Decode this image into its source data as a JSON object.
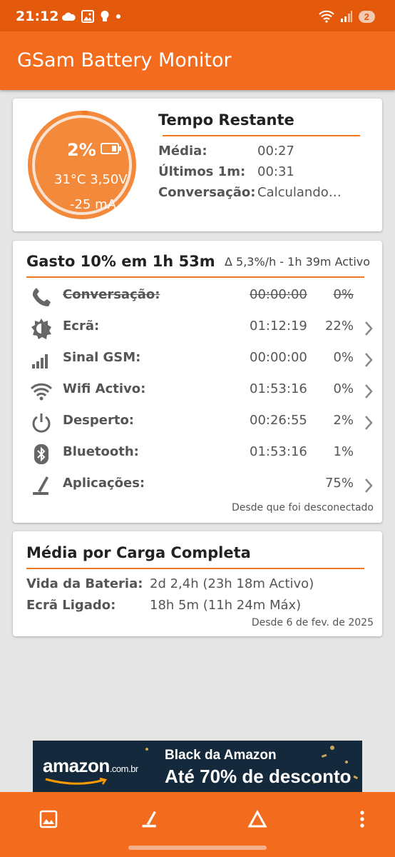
{
  "status_bar": {
    "time": "21:12",
    "notification_badge": "2",
    "icons": [
      "cloud-icon",
      "gallery-icon",
      "bulb-icon",
      "dot-icon",
      "wifi-icon",
      "signal-icon"
    ]
  },
  "app_bar": {
    "title": "GSam Battery Monitor"
  },
  "gauge": {
    "percent": "2%",
    "level_fraction": 0.02,
    "temp_voltage": "31°C  3,50V",
    "current": "-25 mA"
  },
  "tempo_restante": {
    "title": "Tempo Restante",
    "rows": [
      {
        "label": "Média:",
        "value": "00:27"
      },
      {
        "label": "Últimos 1m:",
        "value": "00:31"
      },
      {
        "label": "Conversação:",
        "value": "Calculando…"
      }
    ]
  },
  "gasto": {
    "title": "Gasto 10% em 1h 53m",
    "delta": "Δ 5,3%/h - 1h 39m Activo",
    "rows": [
      {
        "icon": "phone-icon",
        "label": "Conversação:",
        "time": "00:00:00",
        "percent": "0%",
        "struck": true,
        "chevron": false
      },
      {
        "icon": "screen-brightness-icon",
        "label": "Ecrã:",
        "time": "01:12:19",
        "percent": "22%",
        "struck": false,
        "chevron": true
      },
      {
        "icon": "signal-bars-icon",
        "label": "Sinal GSM:",
        "time": "00:00:00",
        "percent": "0%",
        "struck": false,
        "chevron": true
      },
      {
        "icon": "wifi-icon",
        "label": "Wifi Activo:",
        "time": "01:53:16",
        "percent": "0%",
        "struck": false,
        "chevron": true
      },
      {
        "icon": "power-icon",
        "label": "Desperto:",
        "time": "00:26:55",
        "percent": "2%",
        "struck": false,
        "chevron": true
      },
      {
        "icon": "bluetooth-icon",
        "label": "Bluetooth:",
        "time": "01:53:16",
        "percent": "1%",
        "struck": false,
        "chevron": false
      },
      {
        "icon": "apps-icon",
        "label": "Aplicações:",
        "time": "",
        "percent": "75%",
        "struck": false,
        "chevron": true
      }
    ],
    "footer": "Desde que foi desconectado"
  },
  "media_carga": {
    "title": "Média por Carga Completa",
    "rows": [
      {
        "label": "Vida da Bateria:",
        "value": "2d 2,4h (23h 18m Activo)"
      },
      {
        "label": "Ecrã Ligado:",
        "value": "18h 5m (11h 24m Máx)"
      }
    ],
    "footer": "Desde 6 de fev. de 2025"
  },
  "ad": {
    "brand": "amazon",
    "brand_suffix": ".com.br",
    "line1": "Black da Amazon",
    "line2": "Até 70% de desconto"
  },
  "bottom_bar": {
    "icons": [
      "image-icon",
      "apps-icon",
      "delta-icon",
      "more-vert-icon"
    ]
  },
  "colors": {
    "accent": "#f36b1c",
    "status_bar": "#e35a0c",
    "rule": "#f27a20",
    "background": "#e5e5e5"
  }
}
